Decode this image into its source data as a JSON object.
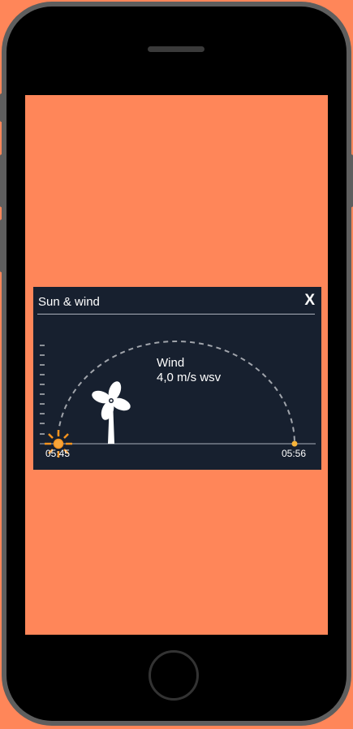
{
  "card": {
    "title": "Sun & wind",
    "close_label": "X",
    "wind_label": "Wind",
    "wind_value": "4,0 m/s wsv",
    "sunrise": "05:45",
    "sunset": "05:56",
    "sun_progress": 0
  },
  "colors": {
    "background": "#ff8659",
    "card": "#17202f",
    "sun": "#f7931e",
    "arc": "#a0a4ab"
  }
}
